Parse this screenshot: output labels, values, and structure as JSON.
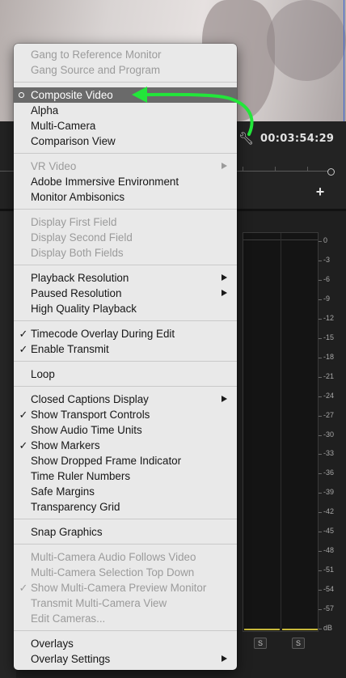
{
  "monitor": {
    "timecode": "00:03:54:29",
    "wrench_icon": "wrench-icon",
    "add_label": "+"
  },
  "meter": {
    "scale": [
      "0",
      "-3",
      "-6",
      "-9",
      "-12",
      "-15",
      "-18",
      "-21",
      "-24",
      "-27",
      "-30",
      "-33",
      "-36",
      "-39",
      "-42",
      "-45",
      "-48",
      "-51",
      "-54",
      "-57",
      "dB"
    ],
    "solo_left": "S",
    "solo_right": "S",
    "bar_color": "#c8b93a"
  },
  "menu": {
    "sections": [
      {
        "items": [
          {
            "label": "Gang to Reference Monitor",
            "disabled": true
          },
          {
            "label": "Gang Source and Program",
            "disabled": true
          }
        ]
      },
      {
        "items": [
          {
            "label": "Composite Video",
            "radio": true,
            "highlighted": true
          },
          {
            "label": "Alpha"
          },
          {
            "label": "Multi-Camera"
          },
          {
            "label": "Comparison View"
          }
        ]
      },
      {
        "items": [
          {
            "label": "VR Video",
            "disabled": true,
            "submenu": true
          },
          {
            "label": "Adobe Immersive Environment"
          },
          {
            "label": "Monitor Ambisonics"
          }
        ]
      },
      {
        "items": [
          {
            "label": "Display First Field",
            "disabled": true
          },
          {
            "label": "Display Second Field",
            "disabled": true
          },
          {
            "label": "Display Both Fields",
            "disabled": true
          }
        ]
      },
      {
        "items": [
          {
            "label": "Playback Resolution",
            "submenu": true
          },
          {
            "label": "Paused Resolution",
            "submenu": true
          },
          {
            "label": "High Quality Playback"
          }
        ]
      },
      {
        "items": [
          {
            "label": "Timecode Overlay During Edit",
            "checked": true
          },
          {
            "label": "Enable Transmit",
            "checked": true
          }
        ]
      },
      {
        "items": [
          {
            "label": "Loop"
          }
        ]
      },
      {
        "items": [
          {
            "label": "Closed Captions Display",
            "submenu": true
          },
          {
            "label": "Show Transport Controls",
            "checked": true
          },
          {
            "label": "Show Audio Time Units"
          },
          {
            "label": "Show Markers",
            "checked": true
          },
          {
            "label": "Show Dropped Frame Indicator"
          },
          {
            "label": "Time Ruler Numbers"
          },
          {
            "label": "Safe Margins"
          },
          {
            "label": "Transparency Grid"
          }
        ]
      },
      {
        "items": [
          {
            "label": "Snap Graphics"
          }
        ]
      },
      {
        "items": [
          {
            "label": "Multi-Camera Audio Follows Video",
            "disabled": true
          },
          {
            "label": "Multi-Camera Selection Top Down",
            "disabled": true
          },
          {
            "label": "Show Multi-Camera Preview Monitor",
            "disabled": true,
            "checked": true
          },
          {
            "label": "Transmit Multi-Camera View",
            "disabled": true
          },
          {
            "label": "Edit Cameras...",
            "disabled": true
          }
        ]
      },
      {
        "items": [
          {
            "label": "Overlays"
          },
          {
            "label": "Overlay Settings",
            "submenu": true
          }
        ]
      }
    ],
    "check_glyph": "✓"
  },
  "colors": {
    "menu_bg": "#e9e9e9",
    "highlight": "#6a6a6a",
    "disabled_text": "#9b9b9b",
    "annotation_arrow": "#22e63a",
    "panel_bg": "#232323"
  }
}
